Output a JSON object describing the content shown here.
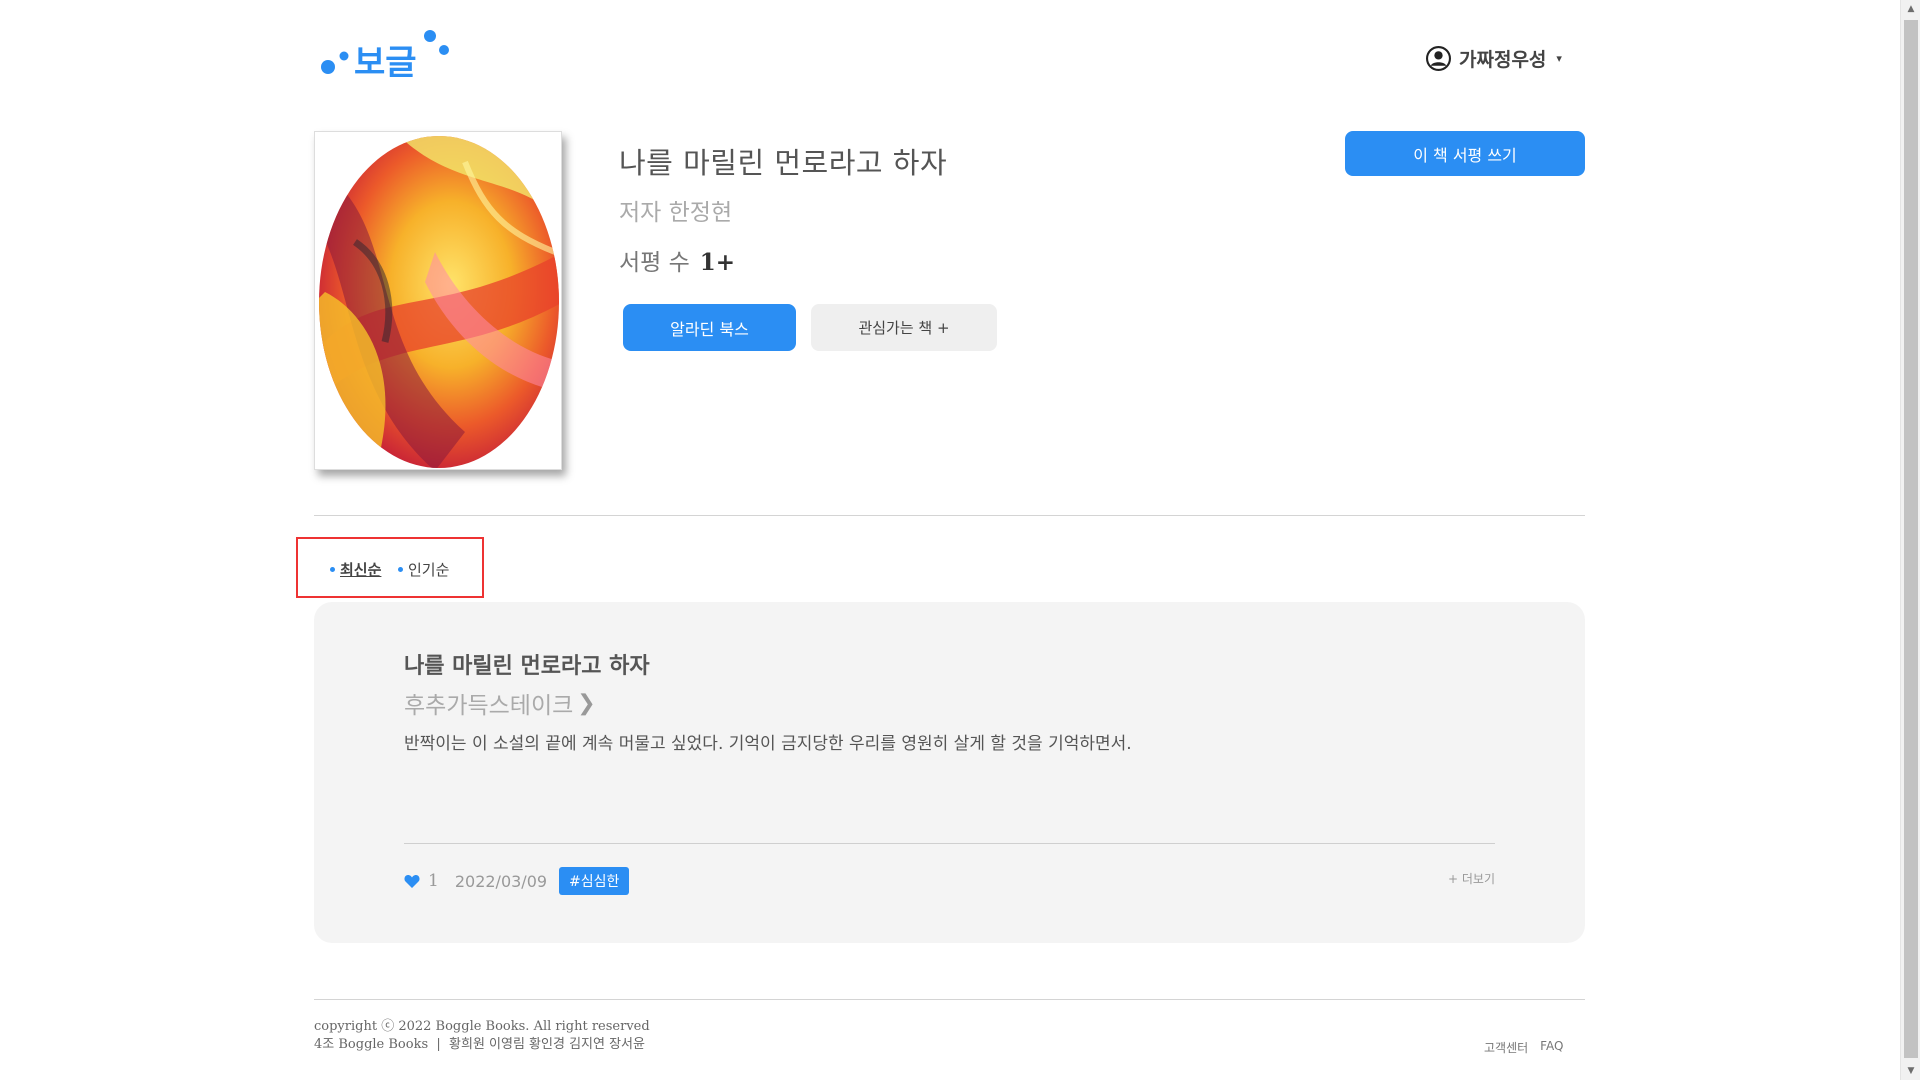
{
  "header": {
    "logo_text": "보글",
    "user_name": "가짜정우성",
    "user_caret": "▾"
  },
  "book": {
    "title": "나를 마릴린 먼로라고 하자",
    "author": "저자 한정현",
    "review_count_label": "서평 수",
    "review_count_value": "1+",
    "write_review_label": "이 책 서평 쓰기",
    "aladin_label": "알라딘 북스",
    "interest_label": "관심가는 책 +"
  },
  "sort": {
    "latest": "최신순",
    "popular": "인기순"
  },
  "review": {
    "book_title": "나를 마릴린 먼로라고 하자",
    "author_name": "후추가득스테이크",
    "body": "반짝이는 이 소설의 끝에 계속 머물고 싶었다. 기억이 금지당한 우리를 영원히 살게 할 것을 기억하면서.",
    "likes": "1",
    "date": "2022/03/09",
    "tag": "#심심한",
    "more_label": "+ 더보기"
  },
  "footer": {
    "copyright": "copyright ⓒ 2022 Boggle Books. All right reserved",
    "team": "4조 Boggle Books  |  황희원 이영림 황인경 김지연 장서윤",
    "help_center": "고객센터",
    "faq": "FAQ"
  },
  "colors": {
    "accent": "#2b8ef3",
    "highlight_box": "#e33333"
  }
}
